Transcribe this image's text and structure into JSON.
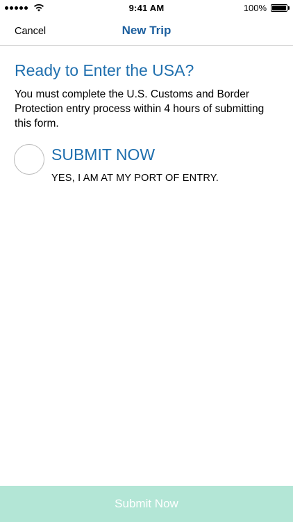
{
  "status_bar": {
    "time": "9:41 AM",
    "battery_percent": "100%",
    "signal_icon": "signal-dots-icon",
    "wifi_icon": "wifi-icon",
    "battery_icon": "battery-icon",
    "battery_level": 1.0
  },
  "nav": {
    "cancel_label": "Cancel",
    "title": "New Trip"
  },
  "content": {
    "heading": "Ready to Enter the USA?",
    "description": "You must complete the U.S. Customs and Border Protection entry process within 4 hours of submitting this form.",
    "option": {
      "title": "SUBMIT NOW",
      "subtitle": "YES, I AM AT MY PORT OF ENTRY.",
      "selected": false
    }
  },
  "footer": {
    "submit_label": "Submit Now",
    "enabled": false
  },
  "colors": {
    "accent": "#1f6fae",
    "nav_title": "#1c5f9e",
    "submit_disabled_bg": "#b3e6d6",
    "radio_border": "#b9b9b9"
  }
}
